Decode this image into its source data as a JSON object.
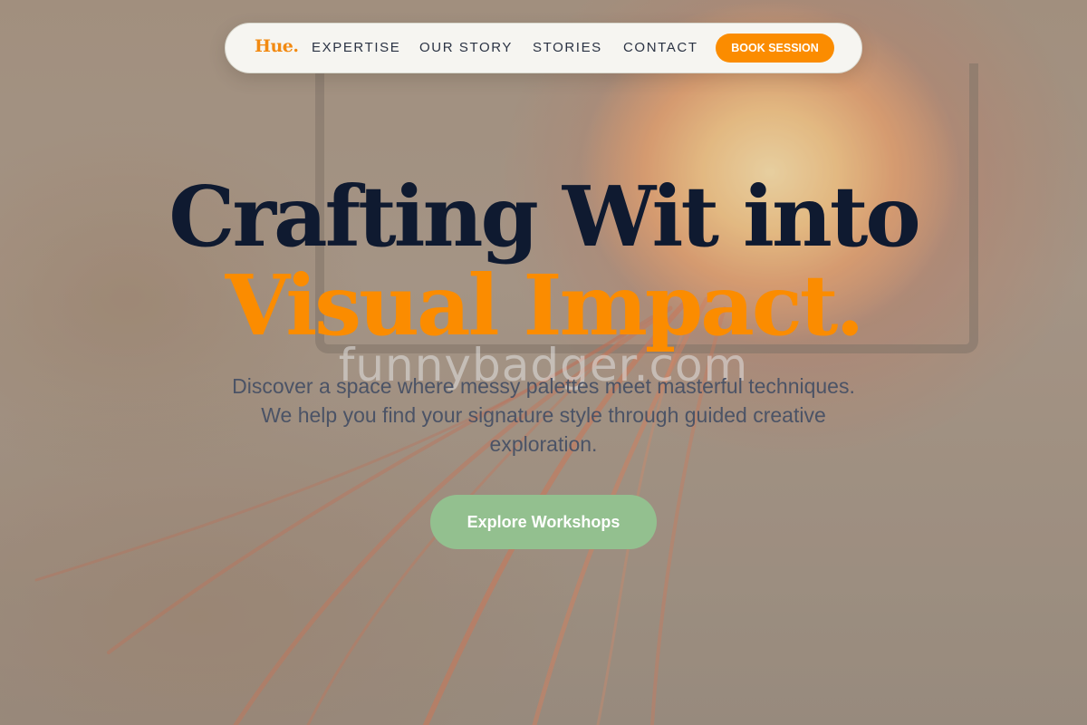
{
  "nav": {
    "logo": "Hue.",
    "links": [
      "EXPERTISE",
      "OUR STORY",
      "STORIES",
      "CONTACT"
    ],
    "book_label": "BOOK SESSION"
  },
  "hero": {
    "headline_line1": "Crafting Wit into",
    "headline_line2": "Visual Impact.",
    "watermark": "funnybadger.com",
    "subtitle": "Discover a space where messy palettes meet masterful techniques. We help you find your signature style through guided creative exploration.",
    "cta_label": "Explore Workshops"
  },
  "colors": {
    "accent": "#fb8c00",
    "headline_dark": "#0f1a30",
    "cta_green": "#93c08f",
    "body_text": "#4b5366",
    "nav_bg": "#f6f5f1"
  }
}
